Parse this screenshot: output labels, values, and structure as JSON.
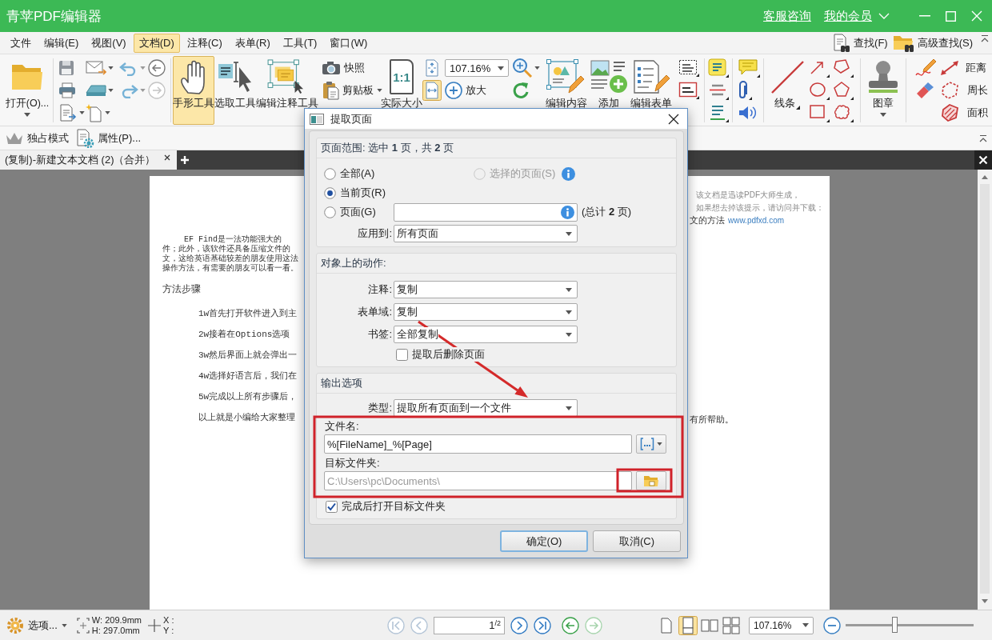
{
  "window": {
    "title": "青苹PDF编辑器",
    "links": [
      "客服咨询",
      "我的会员"
    ]
  },
  "menu": [
    {
      "label": "文件",
      "selected": false
    },
    {
      "label": "编辑(E)",
      "selected": false
    },
    {
      "label": "视图(V)",
      "selected": false
    },
    {
      "label": "文档(D)",
      "selected": true
    },
    {
      "label": "注释(C)",
      "selected": false
    },
    {
      "label": "表单(R)",
      "selected": false
    },
    {
      "label": "工具(T)",
      "selected": false
    },
    {
      "label": "窗口(W)",
      "selected": false
    }
  ],
  "search": [
    "查找(F)",
    "高级查找(S)"
  ],
  "ribbon": {
    "open": "打开(O)...",
    "history": [
      {
        "kind": "back",
        "disabled": false
      },
      {
        "kind": "forward",
        "disabled": true
      }
    ],
    "tools": [
      {
        "kind": "hand",
        "label": "手形工具",
        "selected": true
      },
      {
        "kind": "select",
        "label": "选取工具",
        "selected": false
      },
      {
        "kind": "annotation",
        "label": "编辑注释工具",
        "selected": false
      }
    ],
    "snapshot": "快照",
    "clipboard": "剪贴板",
    "actual_size": {
      "label": "实际大小",
      "glyph": "1:1"
    },
    "fit": [
      {
        "kind": "page",
        "selected": false
      },
      {
        "kind": "width",
        "selected": true
      }
    ],
    "zoom": "107.16%",
    "zoom_in": "放大",
    "edit": [
      {
        "kind": "content",
        "label": "编辑内容"
      },
      {
        "kind": "add",
        "label": "添加"
      },
      {
        "kind": "form",
        "label": "编辑表单"
      }
    ],
    "lines": "线条",
    "stamp": "图章",
    "measure": [
      {
        "kind": "distance",
        "label": "距离"
      },
      {
        "kind": "perimeter",
        "label": "周长"
      },
      {
        "kind": "area",
        "label": "面积"
      }
    ]
  },
  "toolbar": [
    {
      "kind": "exclusive",
      "label": "独占模式"
    },
    {
      "kind": "properties",
      "label": "属性(P)..."
    }
  ],
  "tabs": [
    {
      "label": "(复制)-新建文本文档 (2)（合并）",
      "selected": true
    }
  ],
  "document": {
    "intro": [
      "EF Find是一法功能强大的",
      "件；此外，该软件还具备压缩文件的",
      "文，这给英语基础较差的朋友使用这法",
      "操作方法，有需要的朋友可以看一看。"
    ],
    "heading": "方法步骤",
    "steps": [
      "1w首先打开软件进入到主",
      "2w接着在Options选项",
      "3w然后界面上就会弹出一",
      "4w选择好语言后，我们在",
      "5w完成以上所有步骤后，",
      "以上就是小编给大家整理"
    ],
    "notice": [
      "该文档是迅读PDF大师生成，",
      "如果想去掉该提示，请访问并下载："
    ],
    "fragment": "文的方法",
    "link": "www.pdfxd.com",
    "ending": "有所帮助。"
  },
  "dialog": {
    "title": "提取页面",
    "page_range": {
      "header": "页面范围: 选中 **1** 页，共 **2** 页",
      "options": [
        {
          "kind": "all",
          "label": "全部(A)",
          "selected": false,
          "disabled": false
        },
        {
          "kind": "selection",
          "label": "选择的页面(S)",
          "selected": false,
          "disabled": true
        },
        {
          "kind": "current",
          "label": "当前页(R)",
          "selected": true,
          "disabled": false
        },
        {
          "kind": "range",
          "label": "页面(G)",
          "selected": false,
          "disabled": false
        }
      ],
      "total": "(总计 **2** 页)",
      "apply_label": "应用到:",
      "apply_value": "所有页面"
    },
    "actions": {
      "header": "对象上的动作:",
      "fields": [
        {
          "label": "注释:",
          "value": "复制"
        },
        {
          "label": "表单域:",
          "value": "复制"
        },
        {
          "label": "书签:",
          "value": "全部复制"
        }
      ],
      "delete_after": {
        "label": "提取后删除页面",
        "checked": false
      }
    },
    "output": {
      "header": "输出选项",
      "type_label": "类型:",
      "type_value": "提取所有页面到一个文件",
      "filename": {
        "label": "文件名:",
        "value": "%[FileName]_%[Page]"
      },
      "folder": {
        "label": "目标文件夹:",
        "placeholder": "C:\\Users\\pc\\Documents\\"
      },
      "open_after": {
        "label": "完成后打开目标文件夹",
        "checked": true
      }
    },
    "buttons": [
      {
        "label": "确定(O)",
        "default": true
      },
      {
        "label": "取消(C)",
        "default": false
      }
    ]
  },
  "status_bar": {
    "options": "选项...",
    "size": [
      "W: 209.9mm",
      "H: 297.0mm"
    ],
    "cursor": [
      "X :",
      "Y :"
    ],
    "nav": [
      {
        "kind": "first",
        "disabled": true
      },
      {
        "kind": "prev",
        "disabled": true
      },
      {
        "kind": "next",
        "disabled": false
      },
      {
        "kind": "last",
        "disabled": false
      },
      {
        "kind": "back",
        "disabled": false
      },
      {
        "kind": "forward",
        "disabled": true
      }
    ],
    "page": "1",
    "page_count": "/2",
    "views": [
      {
        "kind": "single",
        "selected": false
      },
      {
        "kind": "continuous",
        "selected": true
      },
      {
        "kind": "facing",
        "selected": false
      },
      {
        "kind": "facing-continuous",
        "selected": false
      }
    ],
    "zoom": "107.16%",
    "zoom_slider": {
      "level": 0.38
    }
  }
}
